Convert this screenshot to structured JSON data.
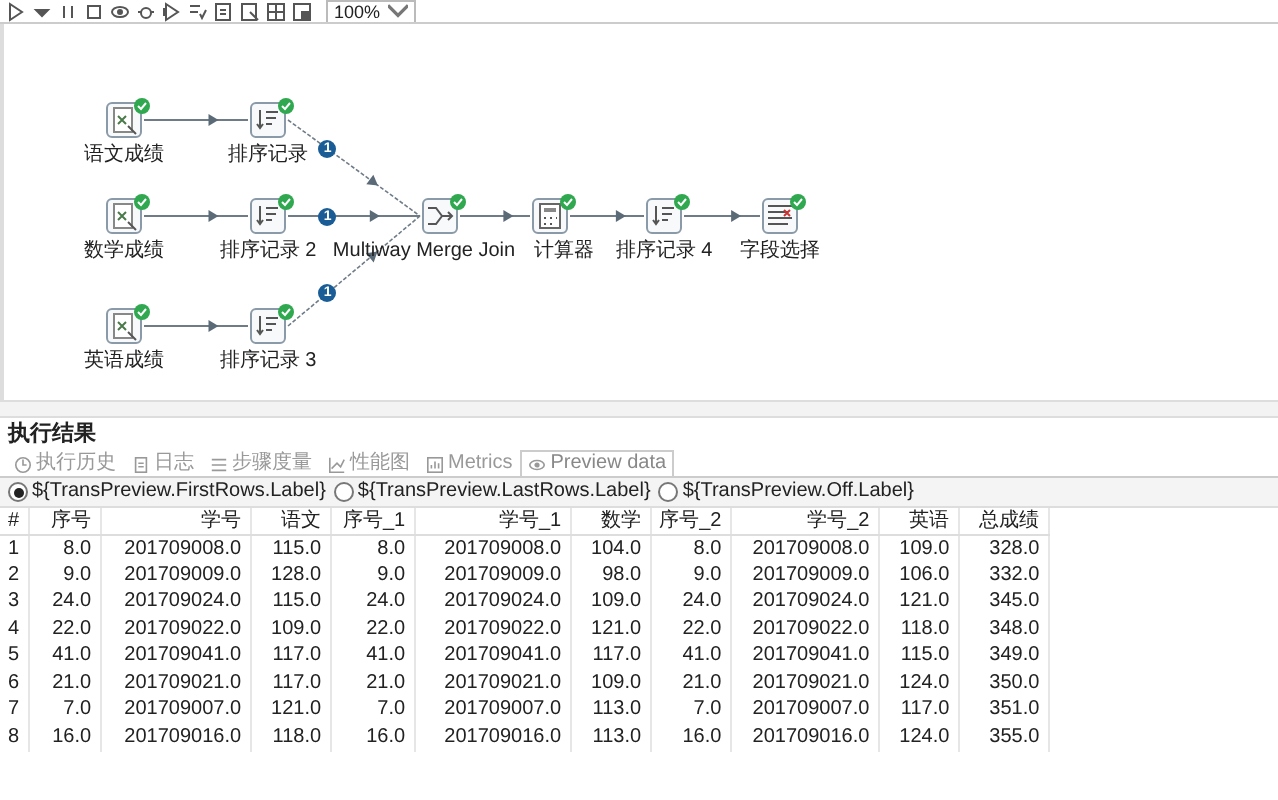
{
  "toolbar": {
    "zoom": "100%"
  },
  "canvas": {
    "nodes": [
      {
        "label": "语文成绩",
        "kind": "input",
        "ok": true
      },
      {
        "label": "排序记录",
        "kind": "sort",
        "ok": true,
        "hop_badge": "1"
      },
      {
        "label": "数学成绩",
        "kind": "input",
        "ok": true
      },
      {
        "label": "排序记录 2",
        "kind": "sort",
        "ok": true,
        "hop_badge": "1"
      },
      {
        "label": "英语成绩",
        "kind": "input",
        "ok": true
      },
      {
        "label": "排序记录 3",
        "kind": "sort",
        "ok": true,
        "hop_badge": "1"
      },
      {
        "label": "Multiway Merge Join",
        "kind": "merge",
        "ok": true
      },
      {
        "label": "计算器",
        "kind": "calc",
        "ok": true
      },
      {
        "label": "排序记录 4",
        "kind": "sort",
        "ok": true
      },
      {
        "label": "字段选择",
        "kind": "select",
        "ok": true
      }
    ]
  },
  "results": {
    "title": "执行结果",
    "tabs": [
      {
        "label": "执行历史",
        "kind": "history",
        "selected": false
      },
      {
        "label": "日志",
        "kind": "log",
        "selected": false
      },
      {
        "label": "步骤度量",
        "kind": "metrics",
        "selected": false
      },
      {
        "label": "性能图",
        "kind": "chart",
        "selected": false
      },
      {
        "label": "Metrics",
        "kind": "metrics2",
        "selected": false
      },
      {
        "label": "Preview data",
        "kind": "preview",
        "selected": true
      }
    ],
    "options": [
      {
        "label": "${TransPreview.FirstRows.Label}",
        "selected": true
      },
      {
        "label": "${TransPreview.LastRows.Label}",
        "selected": false
      },
      {
        "label": "${TransPreview.Off.Label}",
        "selected": false
      }
    ],
    "table": {
      "columns": [
        "#",
        "序号",
        "学号",
        "语文",
        "序号_1",
        "学号_1",
        "数学",
        "序号_2",
        "学号_2",
        "英语",
        "总成绩"
      ],
      "rows": [
        [
          "1",
          "8.0",
          "201709008.0",
          "115.0",
          "8.0",
          "201709008.0",
          "104.0",
          "8.0",
          "201709008.0",
          "109.0",
          "328.0"
        ],
        [
          "2",
          "9.0",
          "201709009.0",
          "128.0",
          "9.0",
          "201709009.0",
          "98.0",
          "9.0",
          "201709009.0",
          "106.0",
          "332.0"
        ],
        [
          "3",
          "24.0",
          "201709024.0",
          "115.0",
          "24.0",
          "201709024.0",
          "109.0",
          "24.0",
          "201709024.0",
          "121.0",
          "345.0"
        ],
        [
          "4",
          "22.0",
          "201709022.0",
          "109.0",
          "22.0",
          "201709022.0",
          "121.0",
          "22.0",
          "201709022.0",
          "118.0",
          "348.0"
        ],
        [
          "5",
          "41.0",
          "201709041.0",
          "117.0",
          "41.0",
          "201709041.0",
          "117.0",
          "41.0",
          "201709041.0",
          "115.0",
          "349.0"
        ],
        [
          "6",
          "21.0",
          "201709021.0",
          "117.0",
          "21.0",
          "201709021.0",
          "109.0",
          "21.0",
          "201709021.0",
          "124.0",
          "350.0"
        ],
        [
          "7",
          "7.0",
          "201709007.0",
          "121.0",
          "7.0",
          "201709007.0",
          "113.0",
          "7.0",
          "201709007.0",
          "117.0",
          "351.0"
        ],
        [
          "8",
          "16.0",
          "201709016.0",
          "118.0",
          "16.0",
          "201709016.0",
          "113.0",
          "16.0",
          "201709016.0",
          "124.0",
          "355.0"
        ]
      ]
    }
  }
}
